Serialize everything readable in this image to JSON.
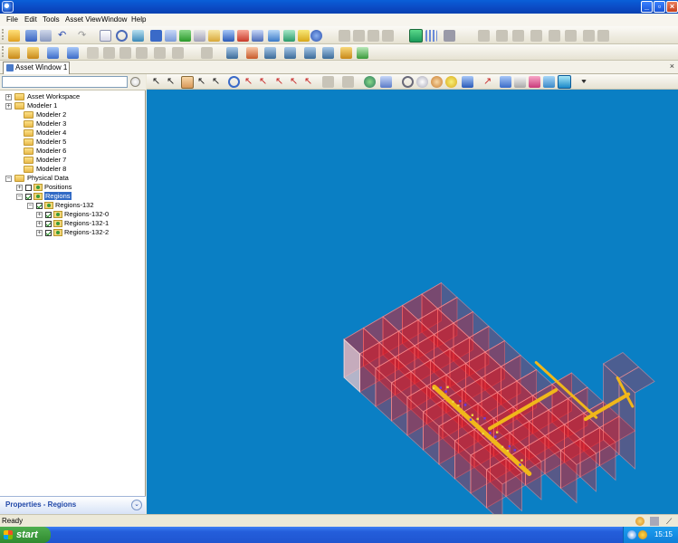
{
  "window": {
    "title": ""
  },
  "menu": [
    "File",
    "Edit",
    "Tools",
    "Asset View",
    "Window",
    "Help"
  ],
  "tabs": [
    {
      "label": "Asset Window 1"
    }
  ],
  "search": {
    "value": "",
    "placeholder": ""
  },
  "tree": [
    {
      "label": "Asset Workspace",
      "type": "folder",
      "expander": "+"
    },
    {
      "label": "Modeler 1",
      "type": "folder",
      "expander": "+"
    },
    {
      "label": "Modeler 2",
      "type": "folder",
      "expander": ""
    },
    {
      "label": "Modeler 3",
      "type": "folder",
      "expander": ""
    },
    {
      "label": "Modeler 4",
      "type": "folder",
      "expander": ""
    },
    {
      "label": "Modeler 5",
      "type": "folder",
      "expander": ""
    },
    {
      "label": "Modeler 6",
      "type": "folder",
      "expander": ""
    },
    {
      "label": "Modeler 7",
      "type": "folder",
      "expander": ""
    },
    {
      "label": "Modeler 8",
      "type": "folder",
      "expander": ""
    },
    {
      "label": "Physical Data",
      "type": "folder",
      "expander": "-"
    },
    {
      "label": "Positions",
      "type": "node",
      "expander": "+",
      "checked": false
    },
    {
      "label": "Regions",
      "type": "node",
      "expander": "-",
      "checked": true,
      "selected": true
    },
    {
      "label": "Regions-132",
      "type": "node",
      "expander": "-",
      "checked": true
    },
    {
      "label": "Regions-132-0",
      "type": "node",
      "expander": "+",
      "checked": true
    },
    {
      "label": "Regions-132-1",
      "type": "node",
      "expander": "+",
      "checked": true
    },
    {
      "label": "Regions-132-2",
      "type": "node",
      "expander": "+",
      "checked": true
    }
  ],
  "properties": {
    "label": "Properties - Regions"
  },
  "status": {
    "text": "Ready"
  },
  "taskbar": {
    "start_label": "start",
    "clock": "15:15"
  },
  "colors": {
    "viewport_bg": "#0a7fc4",
    "region_fill": "#e8141b",
    "pipe": "#f0b71a",
    "titlebar": "#0b4fc9"
  }
}
